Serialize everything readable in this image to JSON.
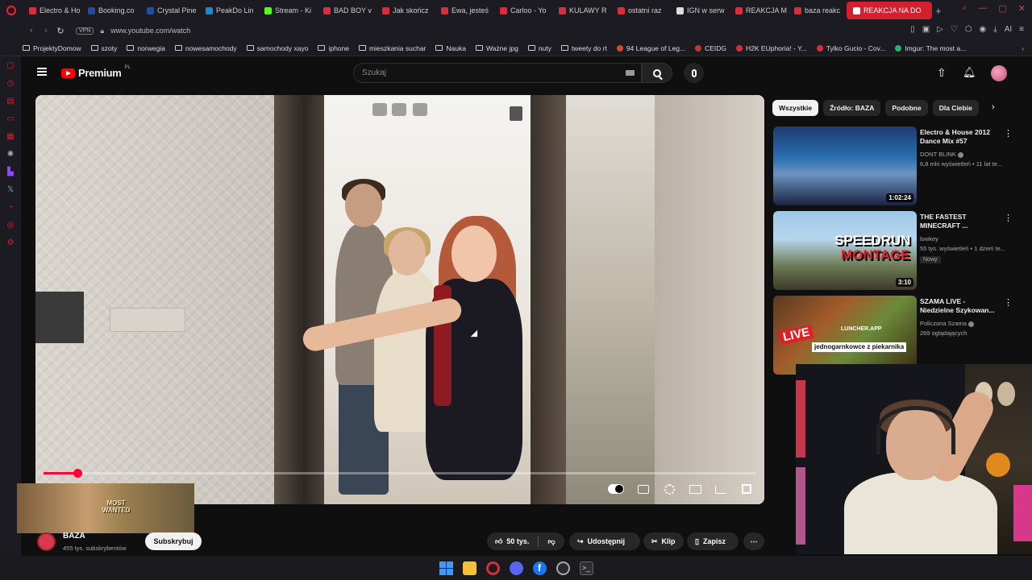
{
  "browser": {
    "tabs": [
      {
        "label": "Electro & Ho",
        "color": "#e0293a"
      },
      {
        "label": "Booking.co",
        "color": "#1c4fa0"
      },
      {
        "label": "Crystal Pine",
        "color": "#1c4fa0"
      },
      {
        "label": "PeakDo Lin",
        "color": "#1a8ad8"
      },
      {
        "label": "Stream - Ki",
        "color": "#53fc18"
      },
      {
        "label": "BAD BOY v",
        "color": "#e0293a"
      },
      {
        "label": "Jak skończ",
        "color": "#e0293a"
      },
      {
        "label": "Ewa, jesteś",
        "color": "#e0293a"
      },
      {
        "label": "Carloo - Yo",
        "color": "#e0293a"
      },
      {
        "label": "KULAWY R",
        "color": "#e0293a"
      },
      {
        "label": "ostatni raz",
        "color": "#e0293a"
      },
      {
        "label": "IGN w serw",
        "color": "#dddddd"
      },
      {
        "label": "REAKCJA M",
        "color": "#e0293a"
      },
      {
        "label": "baza reakc",
        "color": "#e0293a"
      }
    ],
    "active_tab": "REAKCJA NA DO",
    "new_tab": "+",
    "vpn_label": "VPN",
    "url": "www.youtube.com/watch",
    "ai_label": "AI",
    "bookmarks": [
      {
        "label": "ProjektyDomow",
        "icon": "folder-icon"
      },
      {
        "label": "szoty",
        "icon": "folder-icon"
      },
      {
        "label": "norwegia",
        "icon": "folder-icon"
      },
      {
        "label": "nowesamochody",
        "icon": "folder-icon"
      },
      {
        "label": "samochody xayo",
        "icon": "folder-icon"
      },
      {
        "label": "iphone",
        "icon": "folder-icon"
      },
      {
        "label": "mieszkania suchar",
        "icon": "folder-icon"
      },
      {
        "label": "Nauka",
        "icon": "folder-icon"
      },
      {
        "label": "Ważne jpg",
        "icon": "folder-icon"
      },
      {
        "label": "nuty",
        "icon": "folder-icon"
      },
      {
        "label": "tweety do rt",
        "icon": "folder-icon"
      },
      {
        "label": "94 League of Leg...",
        "icon": "site-icon",
        "color": "#d84b2a"
      },
      {
        "label": "CEIDG",
        "icon": "site-icon",
        "color": "#c0392b"
      },
      {
        "label": "H2K EUphoria! - Y...",
        "icon": "site-icon",
        "color": "#e0293a"
      },
      {
        "label": "Tylko Gucio - Cov...",
        "icon": "site-icon",
        "color": "#e0293a"
      },
      {
        "label": "Imgur: The most a...",
        "icon": "site-icon",
        "color": "#1bb76e"
      }
    ]
  },
  "youtube": {
    "logo_word": "Premium",
    "region": "PL",
    "search_placeholder": "Szukaj",
    "player": {
      "progress_fraction": 0.047
    },
    "channel": {
      "name": "BAZA",
      "subscribers": "455 tys. subskrybentów",
      "subscribe_label": "Subskrybuj"
    },
    "game_promo": {
      "title": "MOST WANTED"
    },
    "actions": {
      "likes": "50 tys.",
      "share": "Udostępnij",
      "clip": "Klip",
      "save": "Zapisz"
    },
    "chips": [
      "Wszystkie",
      "Źródło: BAZA",
      "Podobne",
      "Dla Ciebie"
    ],
    "related": [
      {
        "title": "Electro & House 2012 Dance Mix #57",
        "channel": "DONT BLINK",
        "meta": "6,8 mln wyświetleń • 11 lat te...",
        "duration": "1:02:24",
        "badge": ""
      },
      {
        "title": "THE FASTEST MINECRAFT ...",
        "channel": "lowkey",
        "meta": "55 tys. wyświetleń • 1 dzień te...",
        "duration": "3:10",
        "badge": "Nowy",
        "thumb_text_1": "SPEEDRUN",
        "thumb_text_2": "MONTAGE"
      },
      {
        "title": "SZAMA LIVE - Niedzielne Szykowan...",
        "channel": "Policzona Szama",
        "meta": "269 oglądających",
        "duration": "",
        "badge": "",
        "thumb_live": "LIVE",
        "thumb_brand": "LUNCHER.APP",
        "thumb_text": "jednogarnkowce z piekarnika"
      }
    ]
  }
}
